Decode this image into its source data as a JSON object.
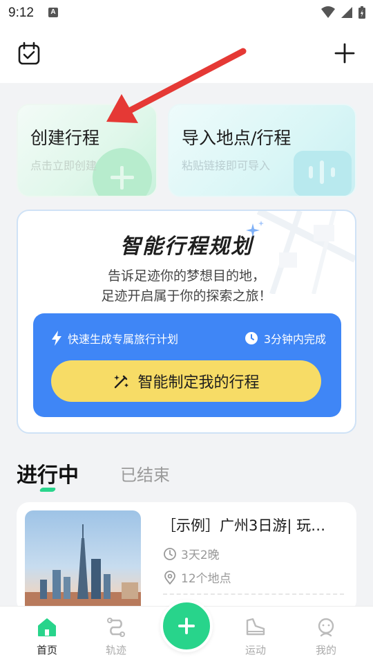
{
  "status_bar": {
    "time": "9:12",
    "notif_letter": "A"
  },
  "quick_actions": {
    "create": {
      "title": "创建行程",
      "subtitle": "点击立即创建"
    },
    "import": {
      "title": "导入地点/行程",
      "subtitle": "粘贴链接即可导入"
    }
  },
  "smart_plan": {
    "title": "智能行程规划",
    "desc_line1": "告诉足迹你的梦想目的地，",
    "desc_line2": "足迹开启属于你的探索之旅！",
    "feature_left": "快速生成专属旅行计划",
    "feature_right": "3分钟内完成",
    "button_label": "智能制定我的行程"
  },
  "tabs": {
    "active": "进行中",
    "inactive": "已结束"
  },
  "trip": {
    "title": "［示例］广州3日游| 玩…",
    "duration": "3天2晚",
    "places": "12个地点"
  },
  "bottom_nav": {
    "items": [
      {
        "label": "首页",
        "icon": "home-icon",
        "active": true
      },
      {
        "label": "轨迹",
        "icon": "track-icon",
        "active": false
      },
      {
        "label": "运动",
        "icon": "shoe-icon",
        "active": false
      },
      {
        "label": "我的",
        "icon": "profile-icon",
        "active": false
      }
    ]
  },
  "colors": {
    "accent_green": "#28d48b",
    "blue": "#3f86f6",
    "yellow": "#f7dc66",
    "annotation_red": "#e53935"
  }
}
